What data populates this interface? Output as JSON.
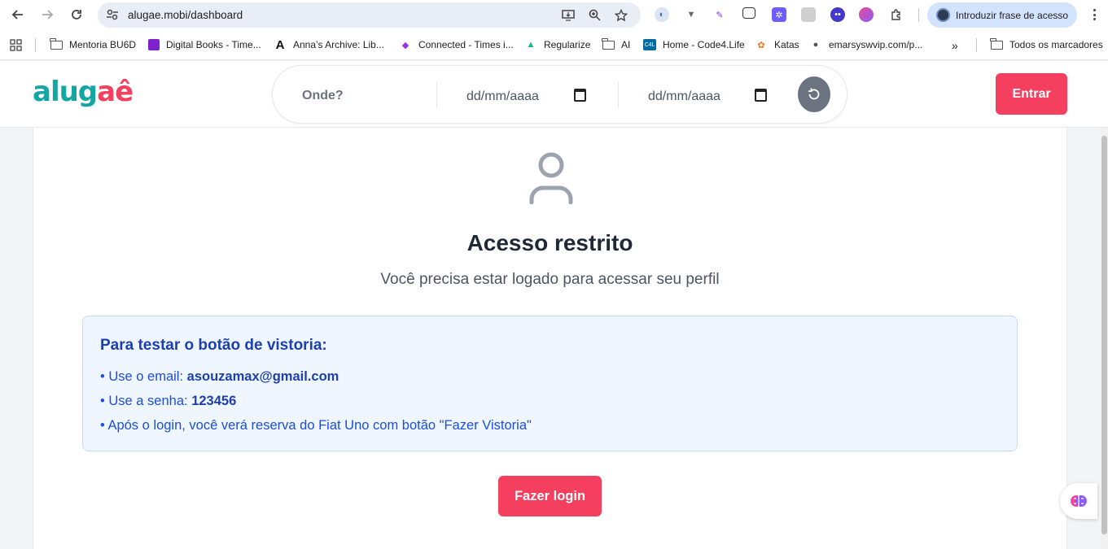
{
  "browser": {
    "url": "alugae.mobi/dashboard",
    "passkey_label": "Introduzir frase de acesso",
    "bookmarks": [
      {
        "label": "Mentoria BU6D",
        "icon": "folder-icon"
      },
      {
        "label": "Digital Books - Time...",
        "icon": "book-icon"
      },
      {
        "label": "Anna’s Archive: Lib...",
        "icon": "anna-archive-icon"
      },
      {
        "label": "Connected - Times i...",
        "icon": "connected-icon"
      },
      {
        "label": "Regularize",
        "icon": "regularize-icon"
      },
      {
        "label": "AI",
        "icon": "folder-icon"
      },
      {
        "label": "Home - Code4.Life",
        "icon": "code4life-icon"
      },
      {
        "label": "Katas",
        "icon": "katas-icon"
      },
      {
        "label": "emarsyswvip.com/p...",
        "icon": "globe-icon"
      }
    ],
    "all_bookmarks_label": "Todos os marcadores"
  },
  "site": {
    "logo_part1": "alug",
    "logo_part2": "aê",
    "search_where_placeholder": "Onde?",
    "date_start_placeholder": "dd/mm/aaaa",
    "date_end_placeholder": "dd/mm/aaaa",
    "login_header_label": "Entrar"
  },
  "main": {
    "title": "Acesso restrito",
    "subtitle": "Você precisa estar logado para acessar seu perfil",
    "info_title": "Para testar o botão de vistoria:",
    "line1_prefix": "• Use o email: ",
    "line1_value": "asouzamax@gmail.com",
    "line2_prefix": "• Use a senha: ",
    "line2_value": "123456",
    "line3": "• Após o login, você verá reserva do Fiat Uno com botão \"Fazer Vistoria\"",
    "login_button_label": "Fazer login"
  },
  "colors": {
    "brand_red": "#f43f5e",
    "brand_teal": "#14a6a2",
    "info_bg": "#eff6ff",
    "info_text": "#1d4ed8"
  }
}
